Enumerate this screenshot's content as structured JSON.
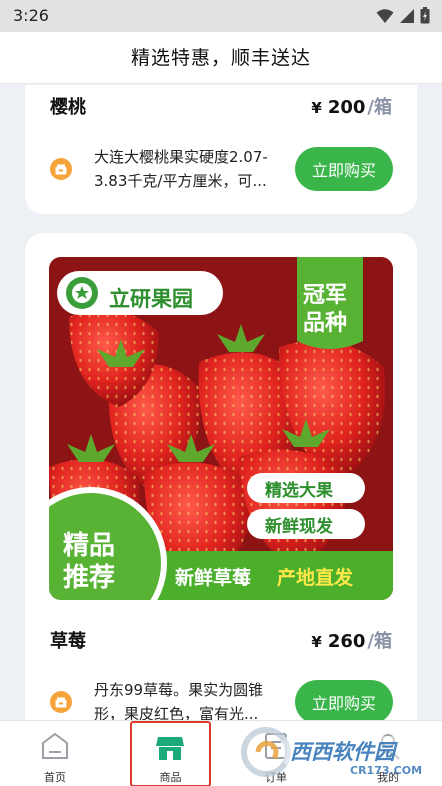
{
  "status": {
    "time": "3:26"
  },
  "header": {
    "title": "精选特惠，顺丰送达"
  },
  "products": [
    {
      "name": "樱桃",
      "currency": "¥",
      "price": "200",
      "unit": "/箱",
      "description": "大连大樱桃果实硬度2.07-3.83千克/平方厘米，可...",
      "buy_label": "立即购买"
    },
    {
      "name": "草莓",
      "currency": "¥",
      "price": "260",
      "unit": "/箱",
      "description": "丹东99草莓。果实为圆锥形，果皮红色，富有光...",
      "buy_label": "立即购买"
    }
  ],
  "banner": {
    "brand": "立研果园",
    "badge_line1": "冠军",
    "badge_line2": "品种",
    "tag1": "精选大果",
    "tag2": "新鲜现发",
    "corner_line1": "精品",
    "corner_line2": "推荐",
    "footer_left": "新鲜草莓",
    "footer_right": "产地直发"
  },
  "tabbar": {
    "items": [
      {
        "label": "首页",
        "icon": "home-icon"
      },
      {
        "label": "商品",
        "icon": "shop-icon"
      },
      {
        "label": "订单",
        "icon": "order-icon"
      },
      {
        "label": "我的",
        "icon": "user-icon"
      }
    ]
  },
  "watermark": {
    "site": "西西软件园",
    "domain": "CR173.COM"
  },
  "colors": {
    "accent_green": "#3ab54a",
    "brand_green": "#4caf2c",
    "active_outline": "#d93a2b",
    "shop_icon_orange": "#f6a43a",
    "unit_gray": "#8a92a6"
  }
}
